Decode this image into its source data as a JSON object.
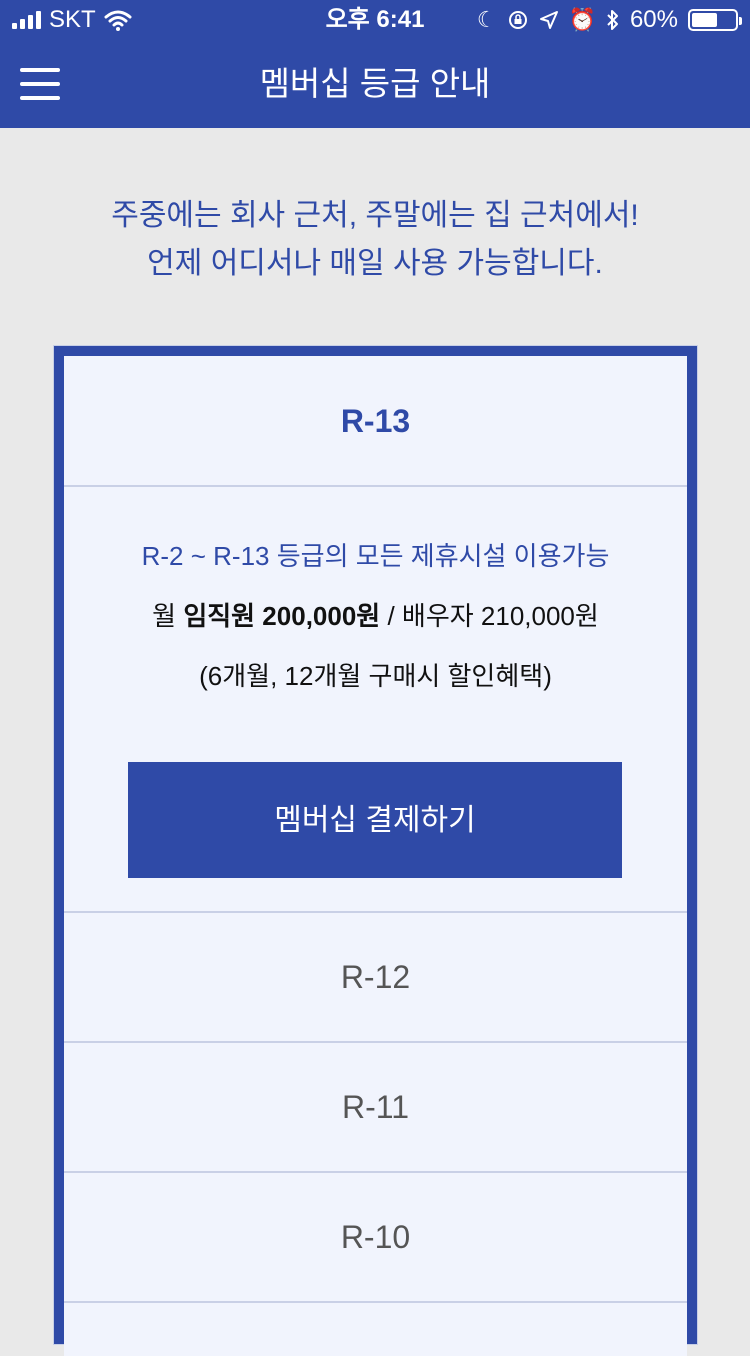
{
  "status_bar": {
    "carrier": "SKT",
    "time": "오후 6:41",
    "battery_percent": "60%",
    "battery_level": 0.6
  },
  "header": {
    "title": "멤버십 등급 안내"
  },
  "intro": {
    "line1": "주중에는 회사 근처, 주말에는 집 근처에서!",
    "line2": "언제 어디서나 매일 사용 가능합니다."
  },
  "tiers": [
    {
      "name": "R-13",
      "expanded": true,
      "description": "R-2 ~ R-13 등급의 모든 제휴시설 이용가능",
      "price_prefix": "월",
      "price_employee": "임직원 200,000원",
      "price_separator": "/",
      "price_spouse": "배우자 210,000원",
      "discount_note": "(6개월, 12개월 구매시 할인혜택)",
      "button_label": "멤버십 결제하기"
    },
    {
      "name": "R-12",
      "expanded": false
    },
    {
      "name": "R-11",
      "expanded": false
    },
    {
      "name": "R-10",
      "expanded": false
    }
  ],
  "icons": {
    "menu": "hamburger-menu-icon",
    "wifi": "wifi-icon",
    "moon": "do-not-disturb-icon",
    "rotation_lock": "rotation-lock-icon",
    "location": "location-arrow-icon",
    "alarm": "alarm-clock-icon",
    "bluetooth": "bluetooth-icon",
    "battery": "battery-icon"
  },
  "colors": {
    "brand": "#2f4aa7",
    "background": "#e9e9e9",
    "card_background": "#f1f4fd",
    "divider": "#c9d0e6"
  }
}
